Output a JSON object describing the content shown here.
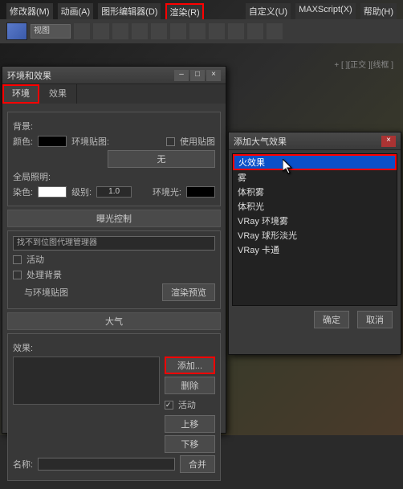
{
  "menu": {
    "items": [
      "修改器(M)",
      "动画(A)",
      "图形编辑器(D)",
      "渲染(R)",
      "自定义(U)",
      "MAXScript(X)",
      "帮助(H)"
    ],
    "hl_index": 3
  },
  "toolbar": {
    "view_label": "视图"
  },
  "right_annot": "+ [ ][正交 ][线框 ]",
  "env_dialog": {
    "title": "环境和效果",
    "tabs": {
      "env": "环境",
      "fx": "效果",
      "active_hl": 0
    },
    "bg": {
      "label": "背景:",
      "color_label": "颜色:",
      "envmap_label": "环境贴图:",
      "usemap_label": "使用贴图",
      "none": "无"
    },
    "gi": {
      "label": "全局照明:",
      "dye_label": "染色:",
      "level_label": "级别:",
      "level_value": "1.0",
      "envlight_label": "环境光:"
    },
    "expose": {
      "title": "曝光控制",
      "dd": "找不到位图代理管理器",
      "active": "活动",
      "procbg": "处理背景",
      "withenv": "与环境贴图",
      "preview": "渲染预览"
    },
    "atmos": {
      "title": "大气",
      "fx_label": "效果:",
      "add": "添加...",
      "delete": "删除",
      "active": "活动",
      "up": "上移",
      "down": "下移",
      "name_label": "名称:",
      "merge": "合并"
    }
  },
  "atm_dialog": {
    "title": "添加大气效果",
    "items": [
      "火效果",
      "雾",
      "体积雾",
      "体积光",
      "VRay 环境雾",
      "VRay 球形淡光",
      "VRay 卡通"
    ],
    "sel_index": 0,
    "ok": "确定",
    "cancel": "取消"
  }
}
